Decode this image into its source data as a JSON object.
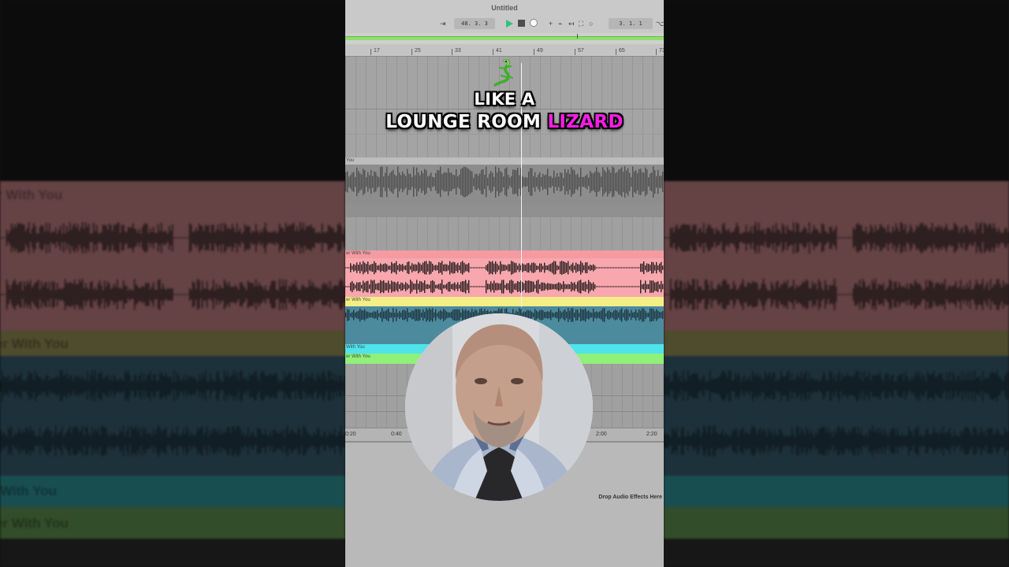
{
  "window": {
    "title": "Untitled"
  },
  "transport": {
    "position": "48. 3. 3",
    "loop_position": "3. 1. 1"
  },
  "ruler": {
    "bars": [
      "17",
      "25",
      "33",
      "41",
      "49",
      "57",
      "65",
      "73"
    ]
  },
  "tracks": [
    {
      "name": "You",
      "color": "#bfbfbf"
    },
    {
      "name": "er With You",
      "color": "#f7a7ad"
    },
    {
      "name": "er With You",
      "color": "#f4ee86"
    },
    {
      "name": "With You",
      "color": "#4fe3ec"
    },
    {
      "name": "er With You",
      "color": "#8ff07a"
    }
  ],
  "timeline": {
    "labels": [
      "0:20",
      "0:40",
      "2:00",
      "2:20"
    ]
  },
  "device_panel": {
    "drop_hint": "Drop Audio Effects Here"
  },
  "captions": {
    "line1": "LIKE A",
    "line2_plain": "LOUNGE ROOM",
    "line2_highlight": "LIZARD"
  },
  "background": {
    "left_titles": [
      "r With You",
      "er With You",
      "With You",
      "er With You"
    ]
  },
  "colors": {
    "accent_green": "#8fe06a",
    "caption_highlight": "#ff1ee6",
    "track_pink": "#f7a7ad",
    "track_yellow": "#f4ee86",
    "track_teal": "#4c8a9e",
    "track_cyan": "#4fe3ec",
    "track_green": "#8ff07a"
  }
}
